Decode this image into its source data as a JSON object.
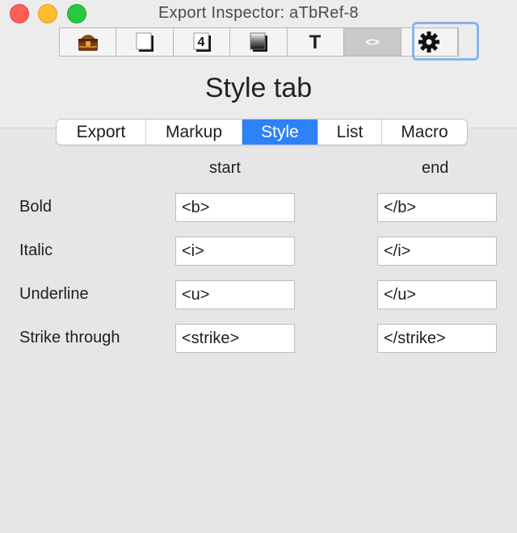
{
  "window": {
    "title": "Export Inspector: aTbRef-8"
  },
  "toolbar": {
    "icons": [
      {
        "name": "export-treasure-icon"
      },
      {
        "name": "blank-page-icon"
      },
      {
        "name": "number-four-icon",
        "glyph": "4"
      },
      {
        "name": "gradient-square-icon"
      },
      {
        "name": "text-t-icon",
        "glyph": "T"
      },
      {
        "name": "code-brackets-icon",
        "glyph": "<>"
      },
      {
        "name": "gear-icon"
      }
    ],
    "selected_index": 5
  },
  "page": {
    "title": "Style tab"
  },
  "tabs": [
    {
      "label": "Export"
    },
    {
      "label": "Markup"
    },
    {
      "label": "Style",
      "active": true
    },
    {
      "label": "List"
    },
    {
      "label": "Macro"
    }
  ],
  "columns": {
    "start": "start",
    "end": "end"
  },
  "rows": [
    {
      "label": "Bold",
      "start": "<b>",
      "end": "</b>"
    },
    {
      "label": "Italic",
      "start": "<i>",
      "end": "</i>"
    },
    {
      "label": "Underline",
      "start": "<u>",
      "end": "</u>"
    },
    {
      "label": "Strike through",
      "start": "<strike>",
      "end": "</strike>"
    }
  ],
  "colors": {
    "accent": "#2d82f7",
    "selection_ring": "#8ab4ec"
  }
}
